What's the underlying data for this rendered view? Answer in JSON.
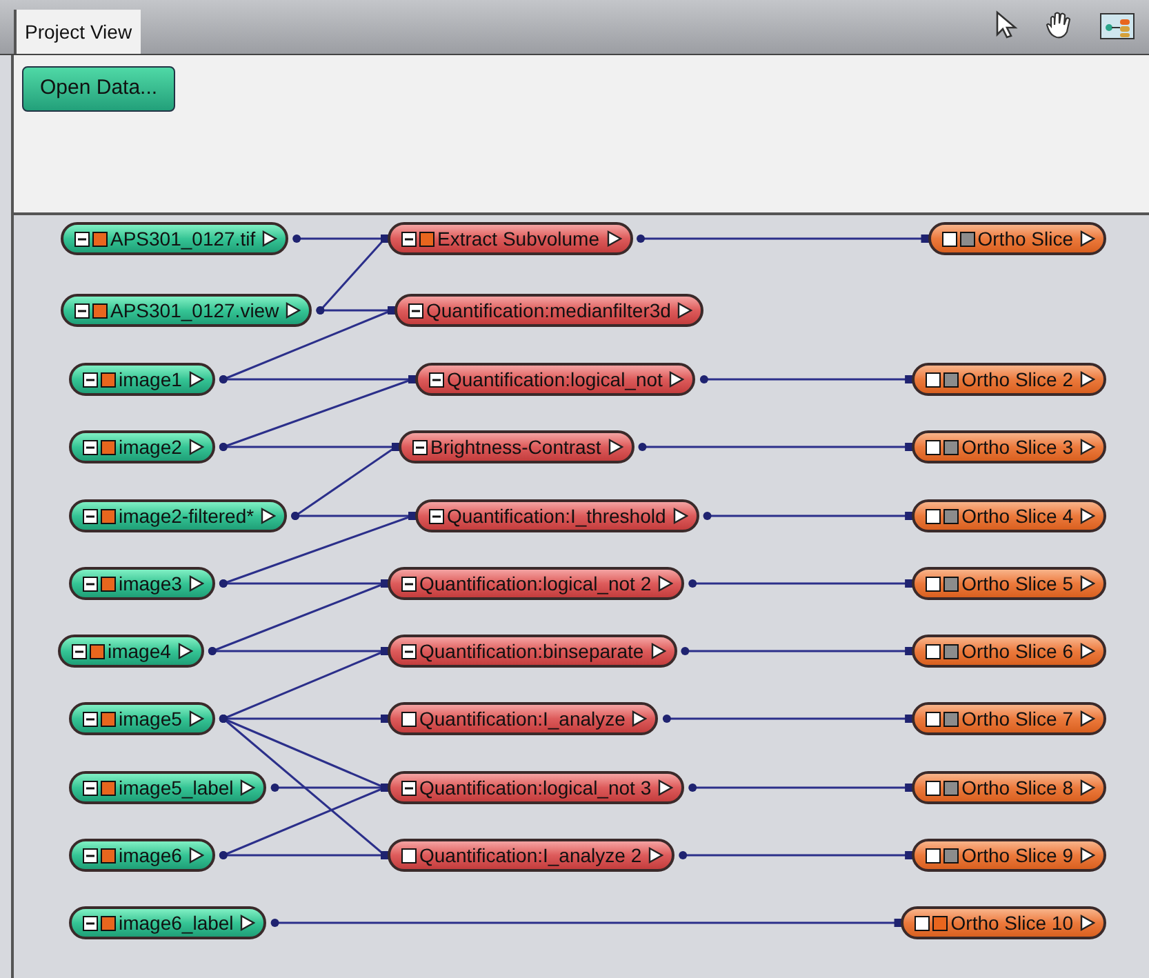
{
  "tab": {
    "label": "Project View",
    "selected": true
  },
  "open_button": "Open Data...",
  "nodes": {
    "data": [
      {
        "label": "APS301_0127.tif",
        "expanded": true,
        "color": "#e8661e"
      },
      {
        "label": "APS301_0127.view",
        "expanded": true,
        "color": "#e8661e"
      },
      {
        "label": "image1",
        "expanded": true,
        "color": "#e8661e"
      },
      {
        "label": "image2",
        "expanded": true,
        "color": "#e8661e"
      },
      {
        "label": "image2-filtered*",
        "expanded": true,
        "color": "#e8661e"
      },
      {
        "label": "image3",
        "expanded": true,
        "color": "#e8661e"
      },
      {
        "label": "image4",
        "expanded": true,
        "color": "#e8661e"
      },
      {
        "label": "image5",
        "expanded": true,
        "color": "#e8661e"
      },
      {
        "label": "image5_label",
        "expanded": true,
        "color": "#e8661e"
      },
      {
        "label": "image6",
        "expanded": true,
        "color": "#e8661e"
      },
      {
        "label": "image6_label",
        "expanded": true,
        "color": "#e8661e"
      }
    ],
    "compute": [
      {
        "label": "Extract Subvolume",
        "expanded": true,
        "color": "#e8661e"
      },
      {
        "label": "Quantification:medianfilter3d",
        "expanded": true
      },
      {
        "label": "Quantification:logical_not",
        "expanded": true
      },
      {
        "label": "Brightness-Contrast",
        "expanded": true
      },
      {
        "label": "Quantification:I_threshold",
        "expanded": true
      },
      {
        "label": "Quantification:logical_not 2",
        "expanded": true
      },
      {
        "label": "Quantification:binseparate",
        "expanded": true
      },
      {
        "label": "Quantification:I_analyze",
        "expanded": false
      },
      {
        "label": "Quantification:logical_not 3",
        "expanded": true
      },
      {
        "label": "Quantification:I_analyze 2",
        "expanded": false
      }
    ],
    "display": [
      {
        "label": "Ortho Slice",
        "expanded": false,
        "color": "#8c8c8c"
      },
      {
        "label": "Ortho Slice 2",
        "expanded": false,
        "color": "#8c8c8c"
      },
      {
        "label": "Ortho Slice 3",
        "expanded": false,
        "color": "#8c8c8c"
      },
      {
        "label": "Ortho Slice 4",
        "expanded": false,
        "color": "#8c8c8c"
      },
      {
        "label": "Ortho Slice 5",
        "expanded": false,
        "color": "#8c8c8c"
      },
      {
        "label": "Ortho Slice 6",
        "expanded": false,
        "color": "#8c8c8c"
      },
      {
        "label": "Ortho Slice 7",
        "expanded": false,
        "color": "#8c8c8c"
      },
      {
        "label": "Ortho Slice 8",
        "expanded": false,
        "color": "#8c8c8c"
      },
      {
        "label": "Ortho Slice 9",
        "expanded": false,
        "color": "#8c8c8c"
      },
      {
        "label": "Ortho Slice 10",
        "expanded": false,
        "color": "#e8661e"
      }
    ]
  }
}
